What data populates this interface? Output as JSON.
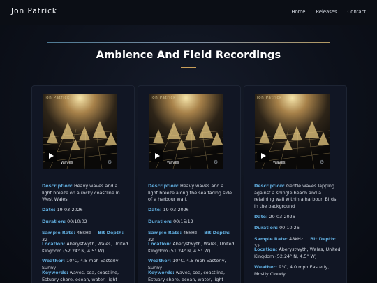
{
  "header": {
    "brand": "Jon Patrick",
    "nav": [
      "Home",
      "Releases",
      "Contact"
    ]
  },
  "section": {
    "title": "Ambience And Field Recordings"
  },
  "labels": {
    "description": "Description:",
    "date": "Date:",
    "duration": "Duration:",
    "sample_rate": "Sample Rate:",
    "bit_depth": "Bit Depth:",
    "location": "Location:",
    "weather": "Weather:",
    "keywords": "Keywords:"
  },
  "cards": [
    {
      "artist": "Jon Patrick",
      "track": "Waves",
      "description": "Heavy waves and a light breeze on a rocky coastline in West Wales.",
      "date": "19-03-2026",
      "duration": "00:10:02",
      "sample_rate": "48kHz",
      "bit_depth": "32",
      "location": "Aberystwyth, Wales, United Kingdom (52.24° N, 4.5° W)",
      "weather": "10°C, 4.5 mph Easterly, Sunny",
      "keywords": "waves, sea, coastline, Estuary shore, ocean, water, light"
    },
    {
      "artist": "Jon Patrick",
      "track": "Waves",
      "description": "Heavy waves and a light breeze along the sea facing side of a harbour wall.",
      "date": "19-03-2026",
      "duration": "00:15:12",
      "sample_rate": "48kHz",
      "bit_depth": "32",
      "location": "Aberystwyth, Wales, United Kingdom (51.24° N, 4.5° W)",
      "weather": "10°C, 4.5 mph Easterly, Sunny",
      "keywords": "waves, sea, coastline, Estuary shore, ocean, water, light"
    },
    {
      "artist": "Jon Patrick",
      "track": "Waves",
      "description": "Gentle waves lapping against a shingle beach and a retaining wall within a harbour. Birds in the background",
      "date": "20-03-2026",
      "duration": "00:10:26",
      "sample_rate": "48kHz",
      "bit_depth": "32",
      "location": "Aberystwyth, Wales, United Kingdom (52.24° N, 4.5° W)",
      "weather": "9°C, 4.0 mph Easterly, Mostly Cloudy",
      "keywords": ""
    }
  ],
  "colors": {
    "label": "#5fa9d9",
    "accent_gold": "#c9a05a",
    "background": "#0d111b"
  },
  "icons": {
    "play": "play-icon",
    "settings": "gear-icon"
  }
}
